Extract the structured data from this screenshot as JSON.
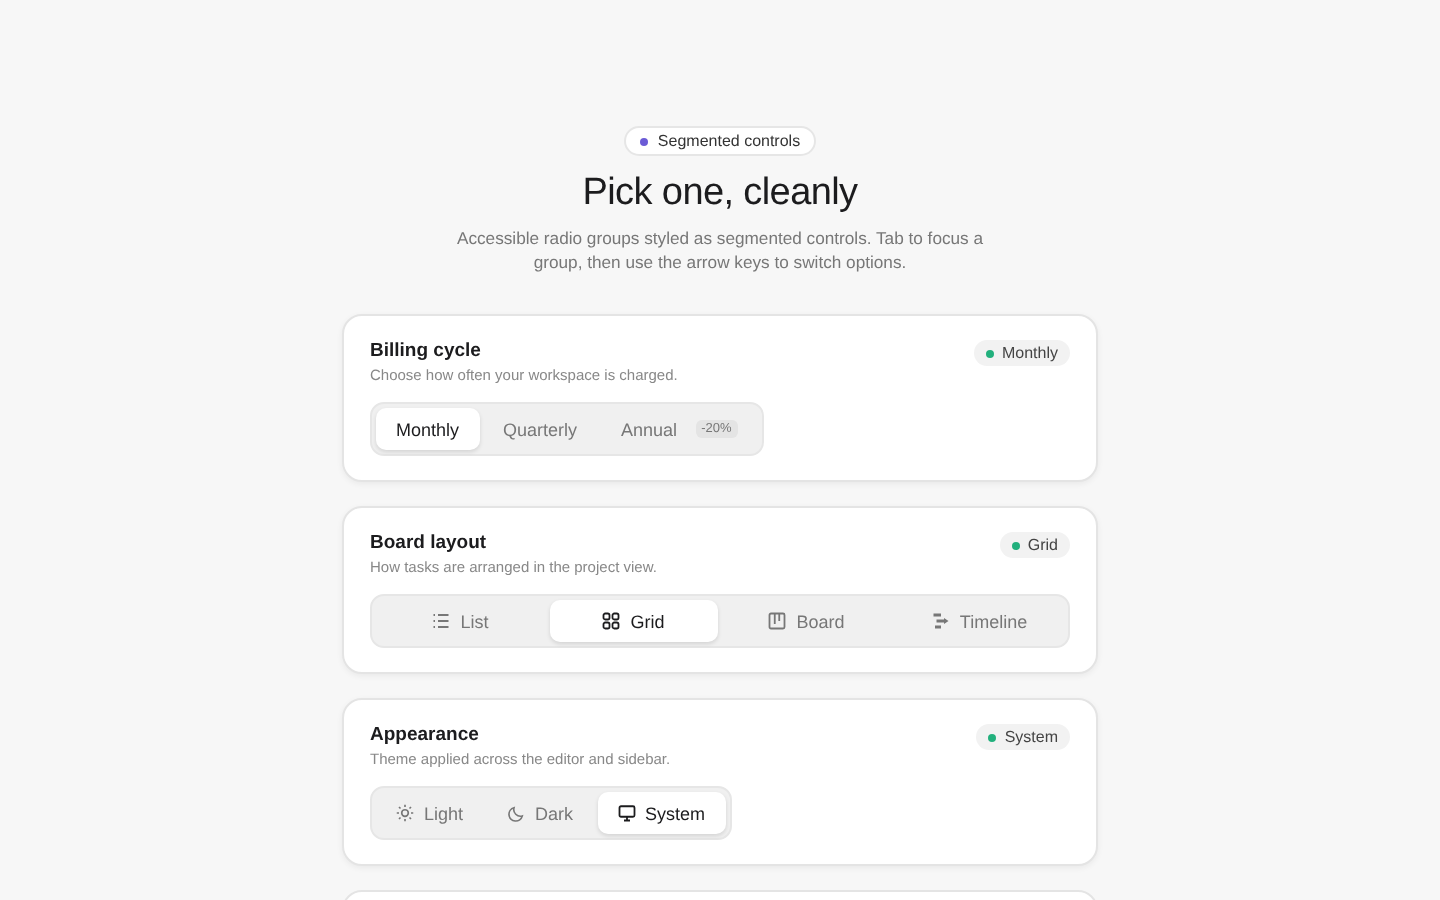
{
  "eyebrow": "Segmented controls",
  "title": "Pick one, cleanly",
  "subtitle": "Accessible radio groups styled as segmented controls. Tab to focus a group, then use the arrow keys to switch options.",
  "groups": [
    {
      "title": "Billing cycle",
      "description": "Choose how often your workspace is charged.",
      "status": "Monthly",
      "options": [
        {
          "label": "Monthly",
          "selected": true
        },
        {
          "label": "Quarterly",
          "selected": false
        },
        {
          "label": "Annual",
          "tag": "-20%",
          "selected": false
        }
      ]
    },
    {
      "title": "Board layout",
      "description": "How tasks are arranged in the project view.",
      "status": "Grid",
      "options": [
        {
          "label": "List",
          "kind": "list",
          "selected": false
        },
        {
          "label": "Grid",
          "kind": "grid",
          "selected": true
        },
        {
          "label": "Board",
          "kind": "board",
          "selected": false
        },
        {
          "label": "Timeline",
          "kind": "timeline",
          "selected": false
        }
      ]
    },
    {
      "title": "Appearance",
      "description": "Theme applied across the editor and sidebar.",
      "status": "System",
      "options": [
        {
          "label": "Light",
          "kind": "sun",
          "selected": false
        },
        {
          "label": "Dark",
          "kind": "moon",
          "selected": false
        },
        {
          "label": "System",
          "kind": "monitor",
          "selected": true
        }
      ]
    }
  ]
}
